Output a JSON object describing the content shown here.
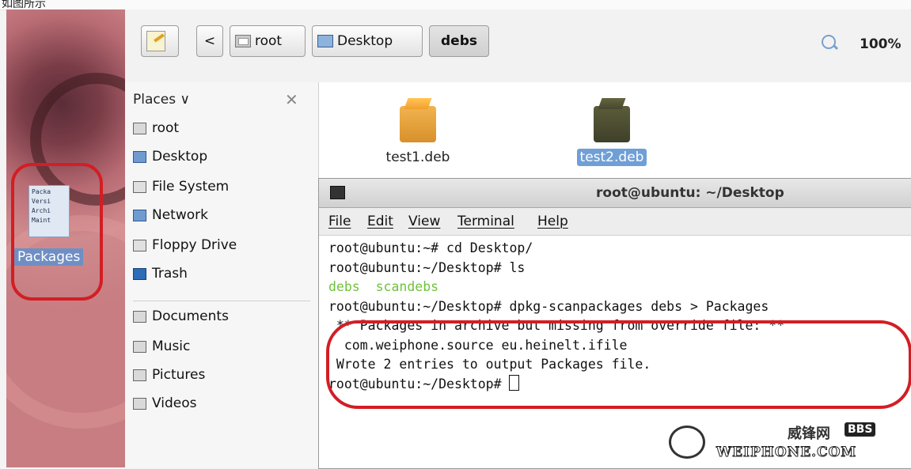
{
  "caption_fragment": "如图所示",
  "desktop": {
    "icon_lines": [
      "Packa",
      "Versi",
      "Archi",
      "Maint"
    ],
    "icon_label": "Packages"
  },
  "toolbar": {
    "back_symbol": "<",
    "crumbs": [
      "root",
      "Desktop",
      "debs"
    ],
    "zoom_level": "100%"
  },
  "sidebar": {
    "header": "Places",
    "chevron": "∨",
    "close_symbol": "✕",
    "items": [
      {
        "label": "root",
        "icon": "folder-home-icon"
      },
      {
        "label": "Desktop",
        "icon": "desktop-icon"
      },
      {
        "label": "File System",
        "icon": "drive-icon"
      },
      {
        "label": "Network",
        "icon": "network-icon"
      },
      {
        "label": "Floppy Drive",
        "icon": "floppy-icon"
      },
      {
        "label": "Trash",
        "icon": "trash-icon"
      },
      {
        "label": "Documents",
        "icon": "folder-icon"
      },
      {
        "label": "Music",
        "icon": "folder-icon"
      },
      {
        "label": "Pictures",
        "icon": "folder-icon"
      },
      {
        "label": "Videos",
        "icon": "folder-icon"
      }
    ]
  },
  "files": [
    {
      "name": "test1.deb",
      "selected": false
    },
    {
      "name": "test2.deb",
      "selected": true
    }
  ],
  "terminal": {
    "title": "root@ubuntu: ~/Desktop",
    "menu": [
      "File",
      "Edit",
      "View",
      "Terminal",
      "Help"
    ],
    "lines": {
      "l1": "root@ubuntu:~# cd Desktop/",
      "l2": "root@ubuntu:~/Desktop# ls",
      "l3a": "debs",
      "l3b": "scandebs",
      "l4": "root@ubuntu:~/Desktop# dpkg-scanpackages debs > Packages",
      "l5": " ** Packages in archive but missing from override file: **",
      "l6": "  com.weiphone.source eu.heinelt.ifile",
      "l7": "",
      "l8": " Wrote 2 entries to output Packages file.",
      "l9": "root@ubuntu:~/Desktop# "
    }
  },
  "watermark": {
    "cn": "威锋网",
    "bbs": "BBS",
    "en": "WEIPHONE.COM"
  },
  "colors": {
    "annotation_red": "#d21e24",
    "selection_blue": "#6f9fd6",
    "terminal_green": "#6fc23c"
  }
}
